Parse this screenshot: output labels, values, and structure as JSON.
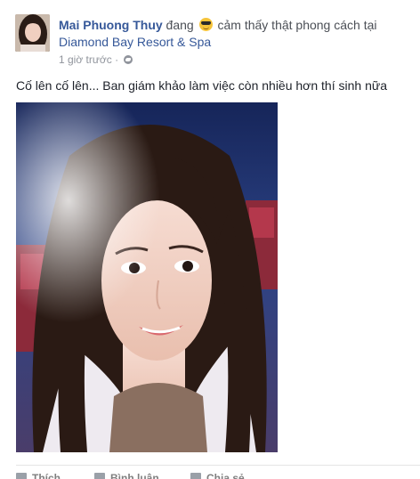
{
  "post": {
    "author": "Mai Phuong Thuy",
    "status_prefix": "đang",
    "feeling_icon": "cool-sunglasses-emoji",
    "status_suffix": "cảm thấy thật phong cách tại",
    "location": "Diamond Bay Resort & Spa",
    "time": "1 giờ trước",
    "separator": "·",
    "privacy_icon": "globe-icon",
    "text": "Cố lên cố lên... Ban giám khảo làm việc còn nhiều hơn thí sinh nữa",
    "photo_alt": "selfie photo"
  },
  "actions": {
    "like": "Thích",
    "comment": "Bình luận",
    "share": "Chia sẻ"
  },
  "colors": {
    "link": "#365899",
    "meta": "#90949c",
    "text": "#1d2129",
    "action": "#7f7f7f"
  }
}
